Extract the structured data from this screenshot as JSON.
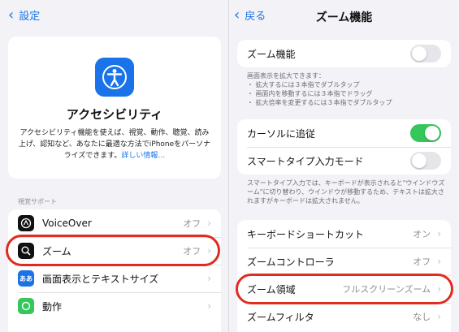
{
  "left": {
    "back_label": "設定",
    "hero": {
      "title": "アクセシビリティ",
      "description": "アクセシビリティ機能を使えば、視覚、動作、聴覚、読み上げ、認知など、あなたに最適な方法でiPhoneをパーソナライズできます。",
      "link": "詳しい情報…"
    },
    "section_header": "視覚サポート",
    "items": [
      {
        "label": "VoiceOver",
        "value": "オフ"
      },
      {
        "label": "ズーム",
        "value": "オフ"
      },
      {
        "label": "画面表示とテキストサイズ",
        "value": ""
      },
      {
        "label": "動作",
        "value": ""
      }
    ],
    "icons": {
      "voiceover": "voiceover-icon",
      "zoom": "zoom-icon",
      "display": "text-size-icon",
      "motion": "motion-icon",
      "hero": "accessibility-icon"
    },
    "icon_text": {
      "display": "ああ"
    }
  },
  "right": {
    "back_label": "戻る",
    "title": "ズーム機能",
    "zoom_toggle": {
      "label": "ズーム機能",
      "on": false
    },
    "instructions_title": "画面表示を拡大できます：",
    "instructions": [
      "・ 拡大するには３本指でダブルタップ",
      "・ 画面内を移動するには３本指でドラッグ",
      "・ 拡大倍率を変更するには３本指でダブルタップ"
    ],
    "follow_focus": {
      "label": "カーソルに追従",
      "on": true
    },
    "smart_typing": {
      "label": "スマートタイプ入力モード",
      "on": false
    },
    "smart_note": "スマートタイプ入力では、キーボードが表示されると\"ウインドウズーム\"に切り替わり、ウインドウが移動するため、テキストは拡大されますがキーボードは拡大されません。",
    "items": [
      {
        "label": "キーボードショートカット",
        "value": "オン"
      },
      {
        "label": "ズームコントローラ",
        "value": "オフ"
      },
      {
        "label": "ズーム領域",
        "value": "フルスクリーンズーム"
      },
      {
        "label": "ズームフィルタ",
        "value": "なし"
      }
    ]
  },
  "colors": {
    "accent": "#1a73e8",
    "highlight": "#e02b1f",
    "toggle_on": "#34c759"
  }
}
